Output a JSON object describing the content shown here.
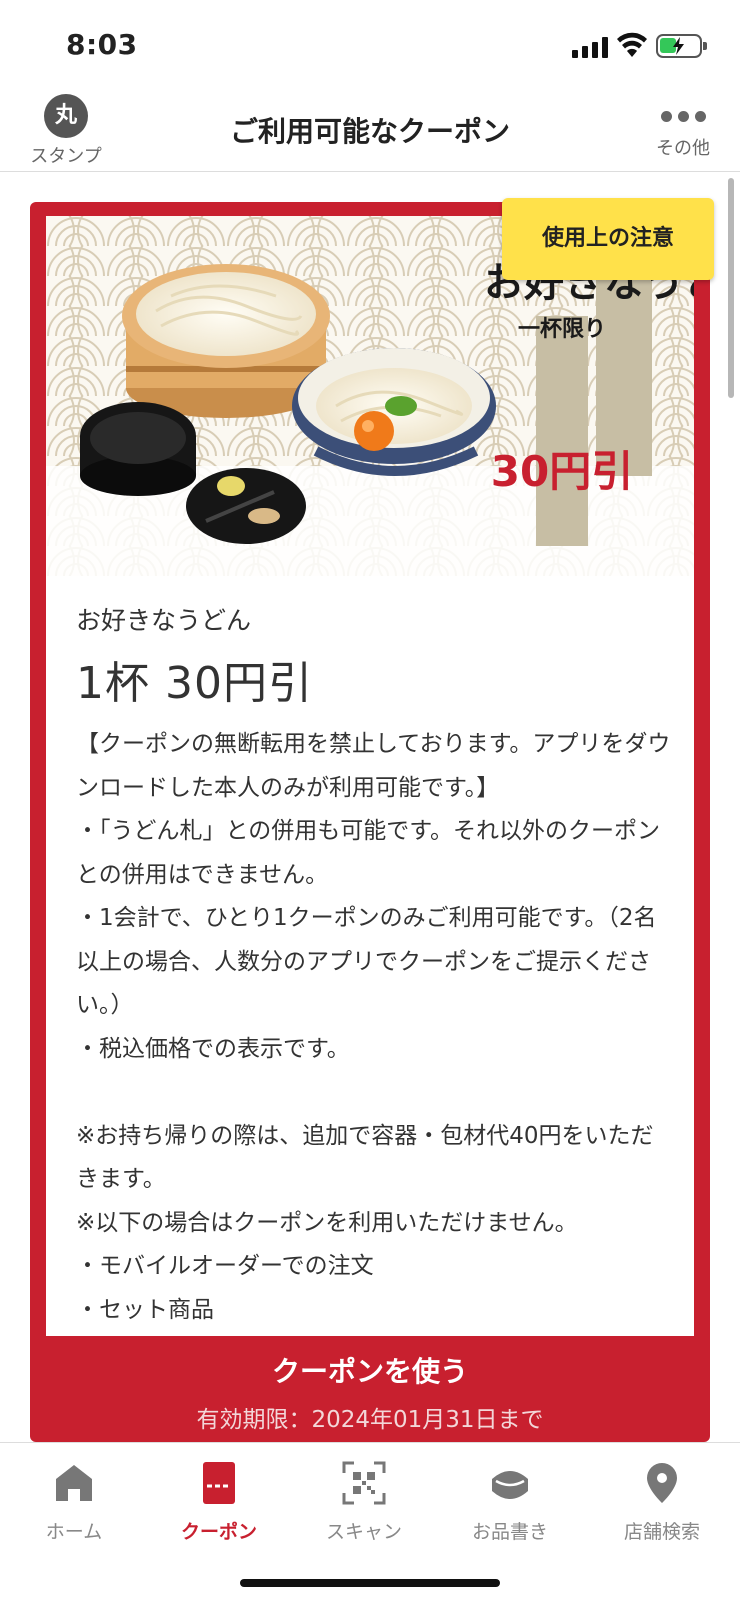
{
  "status_bar": {
    "time": "8:03"
  },
  "header": {
    "title": "ご利用可能なクーポン",
    "stamp_label": "スタンプ",
    "stamp_glyph": "丸",
    "more_label": "その他"
  },
  "coupon": {
    "notice_button": "使用上の注意",
    "hero_image_text": {
      "name": "お好きなうどん",
      "limit": "一杯限り",
      "price": "30円引"
    },
    "name": "お好きなうどん",
    "discount": "1杯 30円引",
    "description": "【クーポンの無断転用を禁止しております。アプリをダウンロードした本人のみが利用可能です。】\n・「うどん札」との併用も可能です。それ以外のクーポンとの併用はできません。\n・1会計で、ひとり1クーポンのみご利用可能です。（2名以上の場合、人数分のアプリでクーポンをご提示ください。）\n・税込価格での表示です。\n\n※お持ち帰りの際は、追加で容器・包材代40円をいただきます。\n※以下の場合はクーポンを利用いただけません。\n・モバイルオーダーでの注文\n・セット商品",
    "use_button": "クーポンを使う",
    "validity": "有効期限：2024年01月31日まで"
  },
  "tabbar": {
    "items": [
      {
        "label": "ホーム",
        "icon": "home-icon"
      },
      {
        "label": "クーポン",
        "icon": "coupon-icon",
        "active": true
      },
      {
        "label": "スキャン",
        "icon": "qr-scan-icon"
      },
      {
        "label": "お品書き",
        "icon": "menu-bowl-icon"
      },
      {
        "label": "店舗検索",
        "icon": "location-pin-icon"
      }
    ]
  },
  "colors": {
    "brand_red": "#c8202f",
    "notice_yellow": "#ffe14a",
    "battery_green": "#34c759"
  }
}
